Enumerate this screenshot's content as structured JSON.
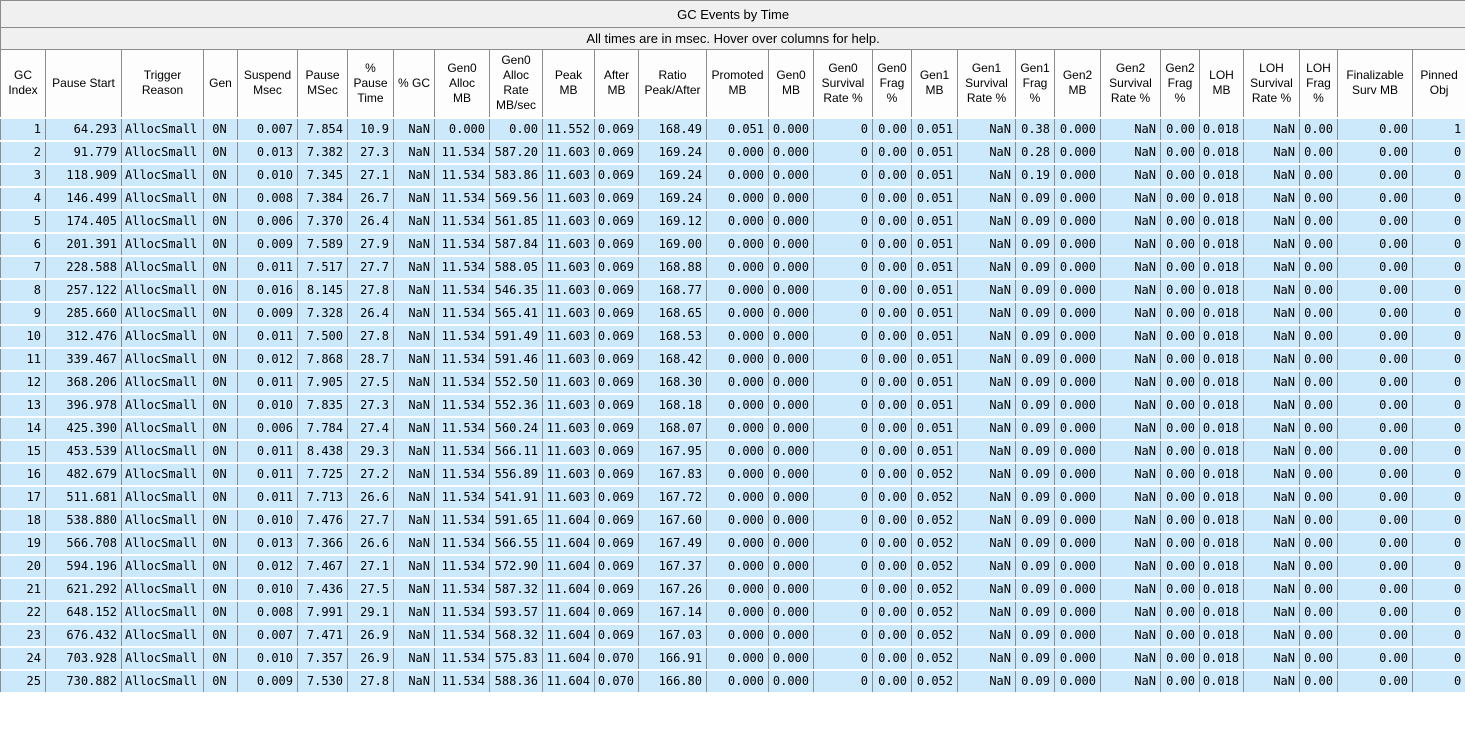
{
  "title": "GC Events by Time",
  "subtitle": "All times are in msec. Hover over columns for help.",
  "colors": {
    "row_bg": "#cbe9fb",
    "header_bg": "#fdfdfd",
    "title_bg": "#f0f0f0",
    "border": "#8c8c8c"
  },
  "table": {
    "columns": [
      "GC\nIndex",
      "Pause Start",
      "Trigger\nReason",
      "Gen",
      "Suspend\nMsec",
      "Pause\nMSec",
      "%\nPause\nTime",
      "% GC",
      "Gen0\nAlloc\nMB",
      "Gen0\nAlloc\nRate\nMB/sec",
      "Peak\nMB",
      "After\nMB",
      "Ratio\nPeak/After",
      "Promoted\nMB",
      "Gen0\nMB",
      "Gen0\nSurvival\nRate %",
      "Gen0\nFrag\n%",
      "Gen1\nMB",
      "Gen1\nSurvival\nRate %",
      "Gen1\nFrag\n%",
      "Gen2\nMB",
      "Gen2\nSurvival\nRate %",
      "Gen2\nFrag\n%",
      "LOH\nMB",
      "LOH\nSurvival\nRate %",
      "LOH\nFrag\n%",
      "Finalizable\nSurv MB",
      "Pinned\nObj"
    ],
    "rows": [
      [
        "1",
        "64.293",
        "AllocSmall",
        "0N",
        "0.007",
        "7.854",
        "10.9",
        "NaN",
        "0.000",
        "0.00",
        "11.552",
        "0.069",
        "168.49",
        "0.051",
        "0.000",
        "0",
        "0.00",
        "0.051",
        "NaN",
        "0.38",
        "0.000",
        "NaN",
        "0.00",
        "0.018",
        "NaN",
        "0.00",
        "0.00",
        "1"
      ],
      [
        "2",
        "91.779",
        "AllocSmall",
        "0N",
        "0.013",
        "7.382",
        "27.3",
        "NaN",
        "11.534",
        "587.20",
        "11.603",
        "0.069",
        "169.24",
        "0.000",
        "0.000",
        "0",
        "0.00",
        "0.051",
        "NaN",
        "0.28",
        "0.000",
        "NaN",
        "0.00",
        "0.018",
        "NaN",
        "0.00",
        "0.00",
        "0"
      ],
      [
        "3",
        "118.909",
        "AllocSmall",
        "0N",
        "0.010",
        "7.345",
        "27.1",
        "NaN",
        "11.534",
        "583.86",
        "11.603",
        "0.069",
        "169.24",
        "0.000",
        "0.000",
        "0",
        "0.00",
        "0.051",
        "NaN",
        "0.19",
        "0.000",
        "NaN",
        "0.00",
        "0.018",
        "NaN",
        "0.00",
        "0.00",
        "0"
      ],
      [
        "4",
        "146.499",
        "AllocSmall",
        "0N",
        "0.008",
        "7.384",
        "26.7",
        "NaN",
        "11.534",
        "569.56",
        "11.603",
        "0.069",
        "169.24",
        "0.000",
        "0.000",
        "0",
        "0.00",
        "0.051",
        "NaN",
        "0.09",
        "0.000",
        "NaN",
        "0.00",
        "0.018",
        "NaN",
        "0.00",
        "0.00",
        "0"
      ],
      [
        "5",
        "174.405",
        "AllocSmall",
        "0N",
        "0.006",
        "7.370",
        "26.4",
        "NaN",
        "11.534",
        "561.85",
        "11.603",
        "0.069",
        "169.12",
        "0.000",
        "0.000",
        "0",
        "0.00",
        "0.051",
        "NaN",
        "0.09",
        "0.000",
        "NaN",
        "0.00",
        "0.018",
        "NaN",
        "0.00",
        "0.00",
        "0"
      ],
      [
        "6",
        "201.391",
        "AllocSmall",
        "0N",
        "0.009",
        "7.589",
        "27.9",
        "NaN",
        "11.534",
        "587.84",
        "11.603",
        "0.069",
        "169.00",
        "0.000",
        "0.000",
        "0",
        "0.00",
        "0.051",
        "NaN",
        "0.09",
        "0.000",
        "NaN",
        "0.00",
        "0.018",
        "NaN",
        "0.00",
        "0.00",
        "0"
      ],
      [
        "7",
        "228.588",
        "AllocSmall",
        "0N",
        "0.011",
        "7.517",
        "27.7",
        "NaN",
        "11.534",
        "588.05",
        "11.603",
        "0.069",
        "168.88",
        "0.000",
        "0.000",
        "0",
        "0.00",
        "0.051",
        "NaN",
        "0.09",
        "0.000",
        "NaN",
        "0.00",
        "0.018",
        "NaN",
        "0.00",
        "0.00",
        "0"
      ],
      [
        "8",
        "257.122",
        "AllocSmall",
        "0N",
        "0.016",
        "8.145",
        "27.8",
        "NaN",
        "11.534",
        "546.35",
        "11.603",
        "0.069",
        "168.77",
        "0.000",
        "0.000",
        "0",
        "0.00",
        "0.051",
        "NaN",
        "0.09",
        "0.000",
        "NaN",
        "0.00",
        "0.018",
        "NaN",
        "0.00",
        "0.00",
        "0"
      ],
      [
        "9",
        "285.660",
        "AllocSmall",
        "0N",
        "0.009",
        "7.328",
        "26.4",
        "NaN",
        "11.534",
        "565.41",
        "11.603",
        "0.069",
        "168.65",
        "0.000",
        "0.000",
        "0",
        "0.00",
        "0.051",
        "NaN",
        "0.09",
        "0.000",
        "NaN",
        "0.00",
        "0.018",
        "NaN",
        "0.00",
        "0.00",
        "0"
      ],
      [
        "10",
        "312.476",
        "AllocSmall",
        "0N",
        "0.011",
        "7.500",
        "27.8",
        "NaN",
        "11.534",
        "591.49",
        "11.603",
        "0.069",
        "168.53",
        "0.000",
        "0.000",
        "0",
        "0.00",
        "0.051",
        "NaN",
        "0.09",
        "0.000",
        "NaN",
        "0.00",
        "0.018",
        "NaN",
        "0.00",
        "0.00",
        "0"
      ],
      [
        "11",
        "339.467",
        "AllocSmall",
        "0N",
        "0.012",
        "7.868",
        "28.7",
        "NaN",
        "11.534",
        "591.46",
        "11.603",
        "0.069",
        "168.42",
        "0.000",
        "0.000",
        "0",
        "0.00",
        "0.051",
        "NaN",
        "0.09",
        "0.000",
        "NaN",
        "0.00",
        "0.018",
        "NaN",
        "0.00",
        "0.00",
        "0"
      ],
      [
        "12",
        "368.206",
        "AllocSmall",
        "0N",
        "0.011",
        "7.905",
        "27.5",
        "NaN",
        "11.534",
        "552.50",
        "11.603",
        "0.069",
        "168.30",
        "0.000",
        "0.000",
        "0",
        "0.00",
        "0.051",
        "NaN",
        "0.09",
        "0.000",
        "NaN",
        "0.00",
        "0.018",
        "NaN",
        "0.00",
        "0.00",
        "0"
      ],
      [
        "13",
        "396.978",
        "AllocSmall",
        "0N",
        "0.010",
        "7.835",
        "27.3",
        "NaN",
        "11.534",
        "552.36",
        "11.603",
        "0.069",
        "168.18",
        "0.000",
        "0.000",
        "0",
        "0.00",
        "0.051",
        "NaN",
        "0.09",
        "0.000",
        "NaN",
        "0.00",
        "0.018",
        "NaN",
        "0.00",
        "0.00",
        "0"
      ],
      [
        "14",
        "425.390",
        "AllocSmall",
        "0N",
        "0.006",
        "7.784",
        "27.4",
        "NaN",
        "11.534",
        "560.24",
        "11.603",
        "0.069",
        "168.07",
        "0.000",
        "0.000",
        "0",
        "0.00",
        "0.051",
        "NaN",
        "0.09",
        "0.000",
        "NaN",
        "0.00",
        "0.018",
        "NaN",
        "0.00",
        "0.00",
        "0"
      ],
      [
        "15",
        "453.539",
        "AllocSmall",
        "0N",
        "0.011",
        "8.438",
        "29.3",
        "NaN",
        "11.534",
        "566.11",
        "11.603",
        "0.069",
        "167.95",
        "0.000",
        "0.000",
        "0",
        "0.00",
        "0.051",
        "NaN",
        "0.09",
        "0.000",
        "NaN",
        "0.00",
        "0.018",
        "NaN",
        "0.00",
        "0.00",
        "0"
      ],
      [
        "16",
        "482.679",
        "AllocSmall",
        "0N",
        "0.011",
        "7.725",
        "27.2",
        "NaN",
        "11.534",
        "556.89",
        "11.603",
        "0.069",
        "167.83",
        "0.000",
        "0.000",
        "0",
        "0.00",
        "0.052",
        "NaN",
        "0.09",
        "0.000",
        "NaN",
        "0.00",
        "0.018",
        "NaN",
        "0.00",
        "0.00",
        "0"
      ],
      [
        "17",
        "511.681",
        "AllocSmall",
        "0N",
        "0.011",
        "7.713",
        "26.6",
        "NaN",
        "11.534",
        "541.91",
        "11.603",
        "0.069",
        "167.72",
        "0.000",
        "0.000",
        "0",
        "0.00",
        "0.052",
        "NaN",
        "0.09",
        "0.000",
        "NaN",
        "0.00",
        "0.018",
        "NaN",
        "0.00",
        "0.00",
        "0"
      ],
      [
        "18",
        "538.880",
        "AllocSmall",
        "0N",
        "0.010",
        "7.476",
        "27.7",
        "NaN",
        "11.534",
        "591.65",
        "11.604",
        "0.069",
        "167.60",
        "0.000",
        "0.000",
        "0",
        "0.00",
        "0.052",
        "NaN",
        "0.09",
        "0.000",
        "NaN",
        "0.00",
        "0.018",
        "NaN",
        "0.00",
        "0.00",
        "0"
      ],
      [
        "19",
        "566.708",
        "AllocSmall",
        "0N",
        "0.013",
        "7.366",
        "26.6",
        "NaN",
        "11.534",
        "566.55",
        "11.604",
        "0.069",
        "167.49",
        "0.000",
        "0.000",
        "0",
        "0.00",
        "0.052",
        "NaN",
        "0.09",
        "0.000",
        "NaN",
        "0.00",
        "0.018",
        "NaN",
        "0.00",
        "0.00",
        "0"
      ],
      [
        "20",
        "594.196",
        "AllocSmall",
        "0N",
        "0.012",
        "7.467",
        "27.1",
        "NaN",
        "11.534",
        "572.90",
        "11.604",
        "0.069",
        "167.37",
        "0.000",
        "0.000",
        "0",
        "0.00",
        "0.052",
        "NaN",
        "0.09",
        "0.000",
        "NaN",
        "0.00",
        "0.018",
        "NaN",
        "0.00",
        "0.00",
        "0"
      ],
      [
        "21",
        "621.292",
        "AllocSmall",
        "0N",
        "0.010",
        "7.436",
        "27.5",
        "NaN",
        "11.534",
        "587.32",
        "11.604",
        "0.069",
        "167.26",
        "0.000",
        "0.000",
        "0",
        "0.00",
        "0.052",
        "NaN",
        "0.09",
        "0.000",
        "NaN",
        "0.00",
        "0.018",
        "NaN",
        "0.00",
        "0.00",
        "0"
      ],
      [
        "22",
        "648.152",
        "AllocSmall",
        "0N",
        "0.008",
        "7.991",
        "29.1",
        "NaN",
        "11.534",
        "593.57",
        "11.604",
        "0.069",
        "167.14",
        "0.000",
        "0.000",
        "0",
        "0.00",
        "0.052",
        "NaN",
        "0.09",
        "0.000",
        "NaN",
        "0.00",
        "0.018",
        "NaN",
        "0.00",
        "0.00",
        "0"
      ],
      [
        "23",
        "676.432",
        "AllocSmall",
        "0N",
        "0.007",
        "7.471",
        "26.9",
        "NaN",
        "11.534",
        "568.32",
        "11.604",
        "0.069",
        "167.03",
        "0.000",
        "0.000",
        "0",
        "0.00",
        "0.052",
        "NaN",
        "0.09",
        "0.000",
        "NaN",
        "0.00",
        "0.018",
        "NaN",
        "0.00",
        "0.00",
        "0"
      ],
      [
        "24",
        "703.928",
        "AllocSmall",
        "0N",
        "0.010",
        "7.357",
        "26.9",
        "NaN",
        "11.534",
        "575.83",
        "11.604",
        "0.070",
        "166.91",
        "0.000",
        "0.000",
        "0",
        "0.00",
        "0.052",
        "NaN",
        "0.09",
        "0.000",
        "NaN",
        "0.00",
        "0.018",
        "NaN",
        "0.00",
        "0.00",
        "0"
      ],
      [
        "25",
        "730.882",
        "AllocSmall",
        "0N",
        "0.009",
        "7.530",
        "27.8",
        "NaN",
        "11.534",
        "588.36",
        "11.604",
        "0.070",
        "166.80",
        "0.000",
        "0.000",
        "0",
        "0.00",
        "0.052",
        "NaN",
        "0.09",
        "0.000",
        "NaN",
        "0.00",
        "0.018",
        "NaN",
        "0.00",
        "0.00",
        "0"
      ]
    ]
  }
}
